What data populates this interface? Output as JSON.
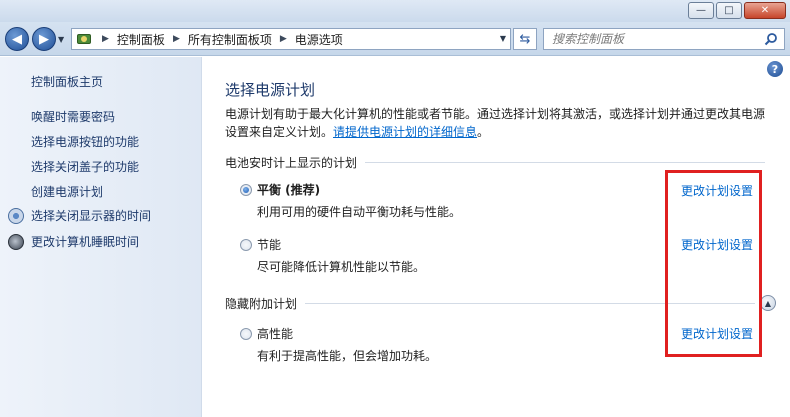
{
  "window": {
    "minimize_glyph": "—",
    "maximize_glyph": "□",
    "close_glyph": "✕"
  },
  "navigation": {
    "back_glyph": "◀",
    "forward_glyph": "▶",
    "breadcrumbs": [
      "控制面板",
      "所有控制面板项",
      "电源选项"
    ],
    "separator": "▶",
    "search_placeholder": "搜索控制面板"
  },
  "sidebar": {
    "home": "控制面板主页",
    "links": [
      "唤醒时需要密码",
      "选择电源按钮的功能",
      "选择关闭盖子的功能",
      "创建电源计划"
    ],
    "icon_links": [
      {
        "label": "选择关闭显示器的时间",
        "icon": "monitor-icon"
      },
      {
        "label": "更改计算机睡眠时间",
        "icon": "sleep-icon"
      }
    ]
  },
  "main": {
    "help_glyph": "?",
    "title": "选择电源计划",
    "intro_text": "电源计划有助于最大化计算机的性能或者节能。通过选择计划将其激活，或选择计划并通过更改其电源设置来自定义计划。",
    "intro_link": "请提供电源计划的详细信息",
    "intro_end": "。",
    "battery_group": "电池安时计上显示的计划",
    "hidden_group": "隐藏附加计划",
    "plans": [
      {
        "name": "平衡 (推荐)",
        "description": "利用可用的硬件自动平衡功耗与性能。",
        "selected": true,
        "change_link": "更改计划设置"
      },
      {
        "name": "节能",
        "description": "尽可能降低计算机性能以节能。",
        "selected": false,
        "change_link": "更改计划设置"
      },
      {
        "name": "高性能",
        "description": "有利于提高性能，但会增加功耗。",
        "selected": false,
        "change_link": "更改计划设置"
      }
    ],
    "collapse_glyph": "▲"
  },
  "colors": {
    "link": "#0066cc",
    "heading": "#1e3a6b",
    "highlight": "#e02020"
  }
}
